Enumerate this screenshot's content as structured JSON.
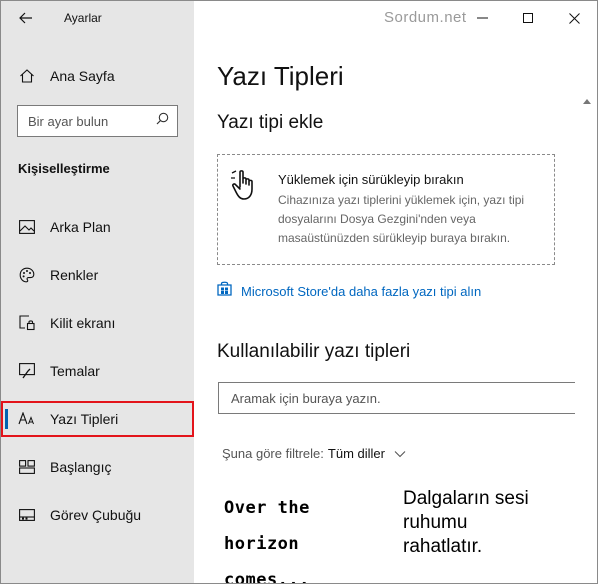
{
  "app": {
    "title": "Ayarlar",
    "watermark": "Sordum.net"
  },
  "sidebar": {
    "home_label": "Ana Sayfa",
    "search_placeholder": "Bir ayar bulun",
    "section_heading": "Kişiselleştirme",
    "items": [
      {
        "label": "Arka Plan",
        "icon": "picture-icon"
      },
      {
        "label": "Renkler",
        "icon": "palette-icon"
      },
      {
        "label": "Kilit ekranı",
        "icon": "lock-screen-icon"
      },
      {
        "label": "Temalar",
        "icon": "theme-brush-icon"
      },
      {
        "label": "Yazı Tipleri",
        "icon": "font-icon",
        "selected": true
      },
      {
        "label": "Başlangıç",
        "icon": "start-tiles-icon"
      },
      {
        "label": "Görev Çubuğu",
        "icon": "taskbar-icon"
      }
    ]
  },
  "main": {
    "page_title": "Yazı Tipleri",
    "add_font_heading": "Yazı tipi ekle",
    "dropzone": {
      "title": "Yüklemek için sürükleyip bırakın",
      "description": "Cihazınıza yazı tiplerini yüklemek için, yazı tipi dosyalarını Dosya Gezgini'nden veya masaüstünüzden sürükleyip buraya bırakın."
    },
    "store_link": "Microsoft Store'da daha fazla yazı tipi alın",
    "available_heading": "Kullanılabilir yazı tipleri",
    "font_search_placeholder": "Aramak için buraya yazın.",
    "filter": {
      "label": "Şuna göre filtrele:",
      "value": "Tüm diller"
    },
    "previews": [
      {
        "lines": [
          "Over the",
          "horizon comes..."
        ]
      },
      {
        "lines": [
          "Dalgaların sesi",
          "ruhumu",
          "rahatlatır."
        ]
      }
    ]
  },
  "colors": {
    "accent": "#0067c0",
    "selection_outline": "#e3141b",
    "sidebar_bg": "#e6e6e6"
  }
}
